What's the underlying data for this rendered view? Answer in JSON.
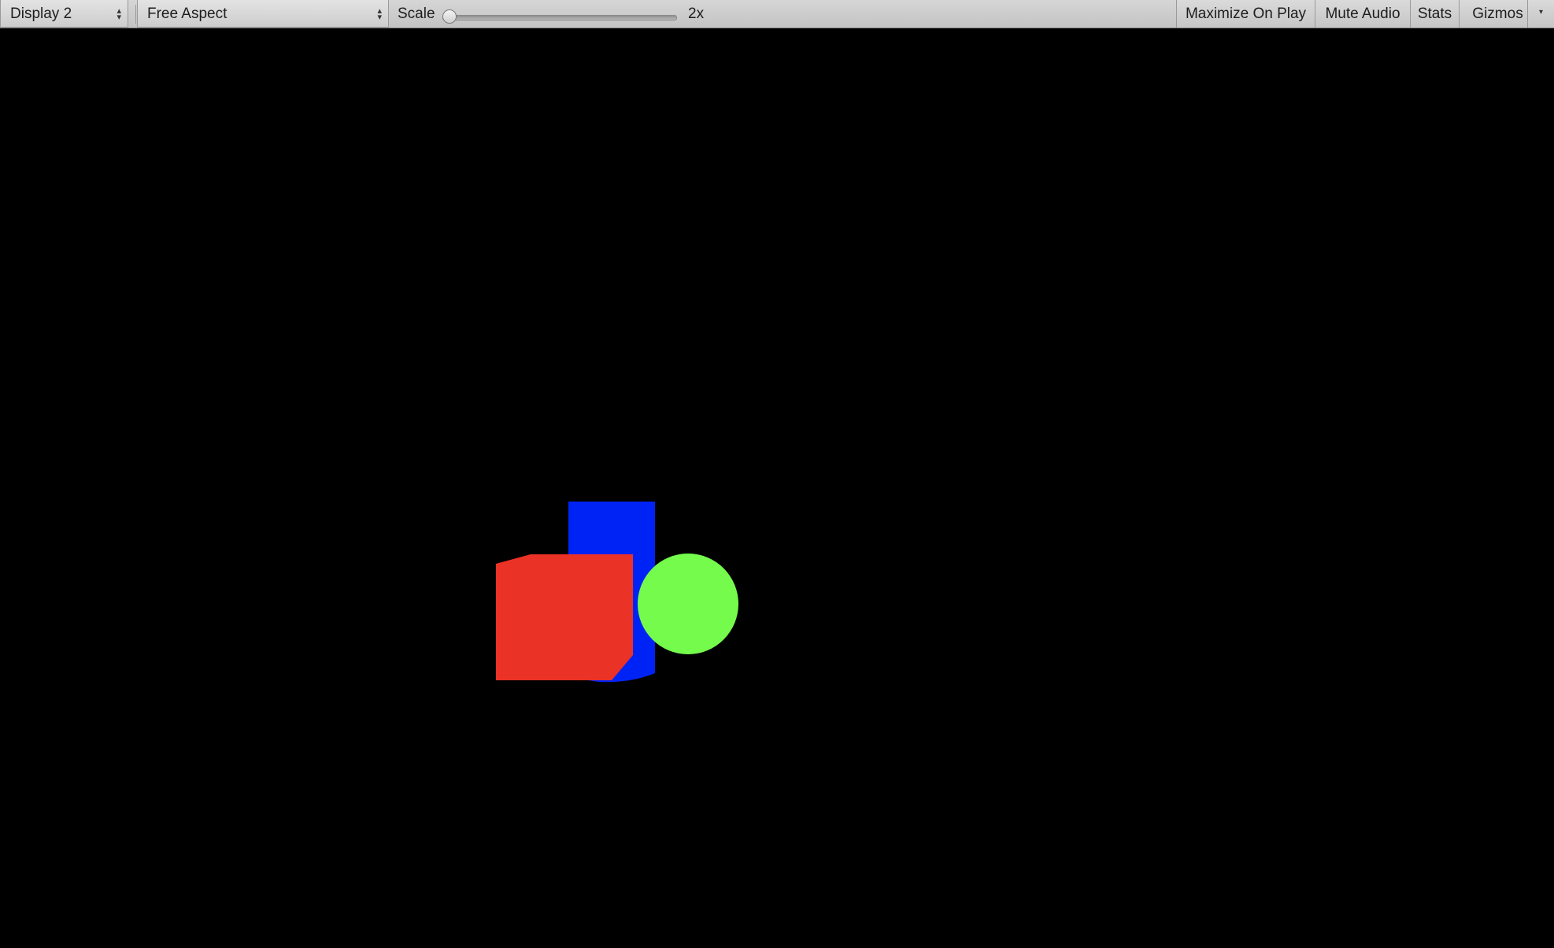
{
  "toolbar": {
    "display_dropdown": "Display 2",
    "aspect_dropdown": "Free Aspect",
    "scale_label": "Scale",
    "scale_value": "2x",
    "scale_slider_fraction": 0.0,
    "maximize_on_play": "Maximize On Play",
    "mute_audio": "Mute Audio",
    "stats": "Stats",
    "gizmos": "Gizmos"
  },
  "scene": {
    "background_color": "#000000",
    "objects": [
      {
        "name": "red-cube",
        "color": "#eb3226"
      },
      {
        "name": "blue-cylinder",
        "color": "#0023f5"
      },
      {
        "name": "green-sphere",
        "color": "#75fb4c"
      }
    ]
  }
}
